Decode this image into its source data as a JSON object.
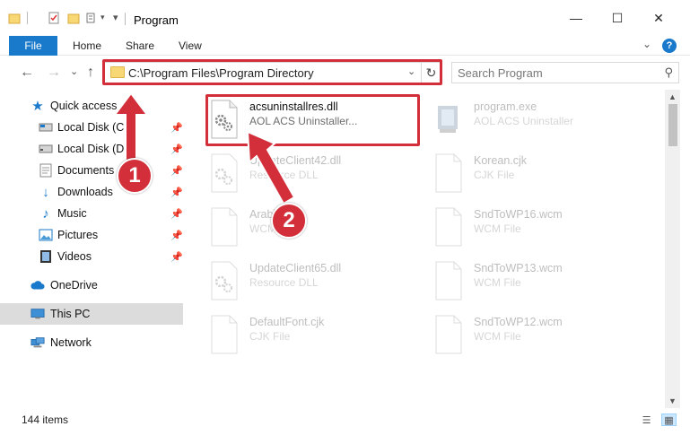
{
  "window": {
    "title": "Program",
    "minimize": "—",
    "maximize": "☐",
    "close": "✕"
  },
  "quick_access_toolbar": {
    "dropdown": "▾"
  },
  "ribbon": {
    "file": "File",
    "home": "Home",
    "share": "Share",
    "view": "View",
    "expand": "⌄",
    "help": "?"
  },
  "nav": {
    "back": "←",
    "forward": "→",
    "recent": "⌄",
    "up": "↑",
    "address": "C:\\Program Files\\Program Directory",
    "address_dropdown": "⌄",
    "refresh": "↻",
    "search_placeholder": "Search Program",
    "search_icon": "⚲"
  },
  "sidebar": {
    "items": [
      {
        "label": "Quick access",
        "icon": "star-icon",
        "pinned": false
      },
      {
        "label": "Local Disk (C:)",
        "icon": "drive-icon",
        "pinned": true
      },
      {
        "label": "Local Disk (D:)",
        "icon": "drive-icon",
        "pinned": true
      },
      {
        "label": "Documents",
        "icon": "documents-icon",
        "pinned": true
      },
      {
        "label": "Downloads",
        "icon": "downloads-icon",
        "pinned": true
      },
      {
        "label": "Music",
        "icon": "music-icon",
        "pinned": true
      },
      {
        "label": "Pictures",
        "icon": "pictures-icon",
        "pinned": true
      },
      {
        "label": "Videos",
        "icon": "videos-icon",
        "pinned": true
      },
      {
        "label": "OneDrive",
        "icon": "cloud-icon",
        "pinned": false
      },
      {
        "label": "This PC",
        "icon": "computer-icon",
        "pinned": false,
        "selected": true
      },
      {
        "label": "Network",
        "icon": "network-icon",
        "pinned": false
      }
    ],
    "pin_glyph": "📌"
  },
  "files": [
    {
      "name": "acsuninstallres.dll",
      "type": "AOL ACS Uninstaller...",
      "icon": "dll-file-icon",
      "highlighted": true
    },
    {
      "name": "program.exe",
      "type": "AOL ACS Uninstaller",
      "icon": "exe-file-icon"
    },
    {
      "name": "UpdateClient42.dll",
      "type": "Resource DLL",
      "icon": "dll-file-icon"
    },
    {
      "name": "Korean.cjk",
      "type": "CJK File",
      "icon": "blank-file-icon"
    },
    {
      "name": "Arabic.cjk",
      "type": "WCM File",
      "icon": "blank-file-icon"
    },
    {
      "name": "SndToWP16.wcm",
      "type": "WCM File",
      "icon": "blank-file-icon"
    },
    {
      "name": "UpdateClient65.dll",
      "type": "Resource DLL",
      "icon": "dll-file-icon"
    },
    {
      "name": "SndToWP13.wcm",
      "type": "WCM File",
      "icon": "blank-file-icon"
    },
    {
      "name": "DefaultFont.cjk",
      "type": "CJK File",
      "icon": "blank-file-icon"
    },
    {
      "name": "SndToWP12.wcm",
      "type": "WCM File",
      "icon": "blank-file-icon"
    }
  ],
  "status": {
    "item_count": "144 items"
  },
  "annotations": {
    "step1": "1",
    "step2": "2"
  },
  "colors": {
    "accent": "#1979ca",
    "highlight": "#d32f3a",
    "selected_row": "#dcdcdc"
  }
}
